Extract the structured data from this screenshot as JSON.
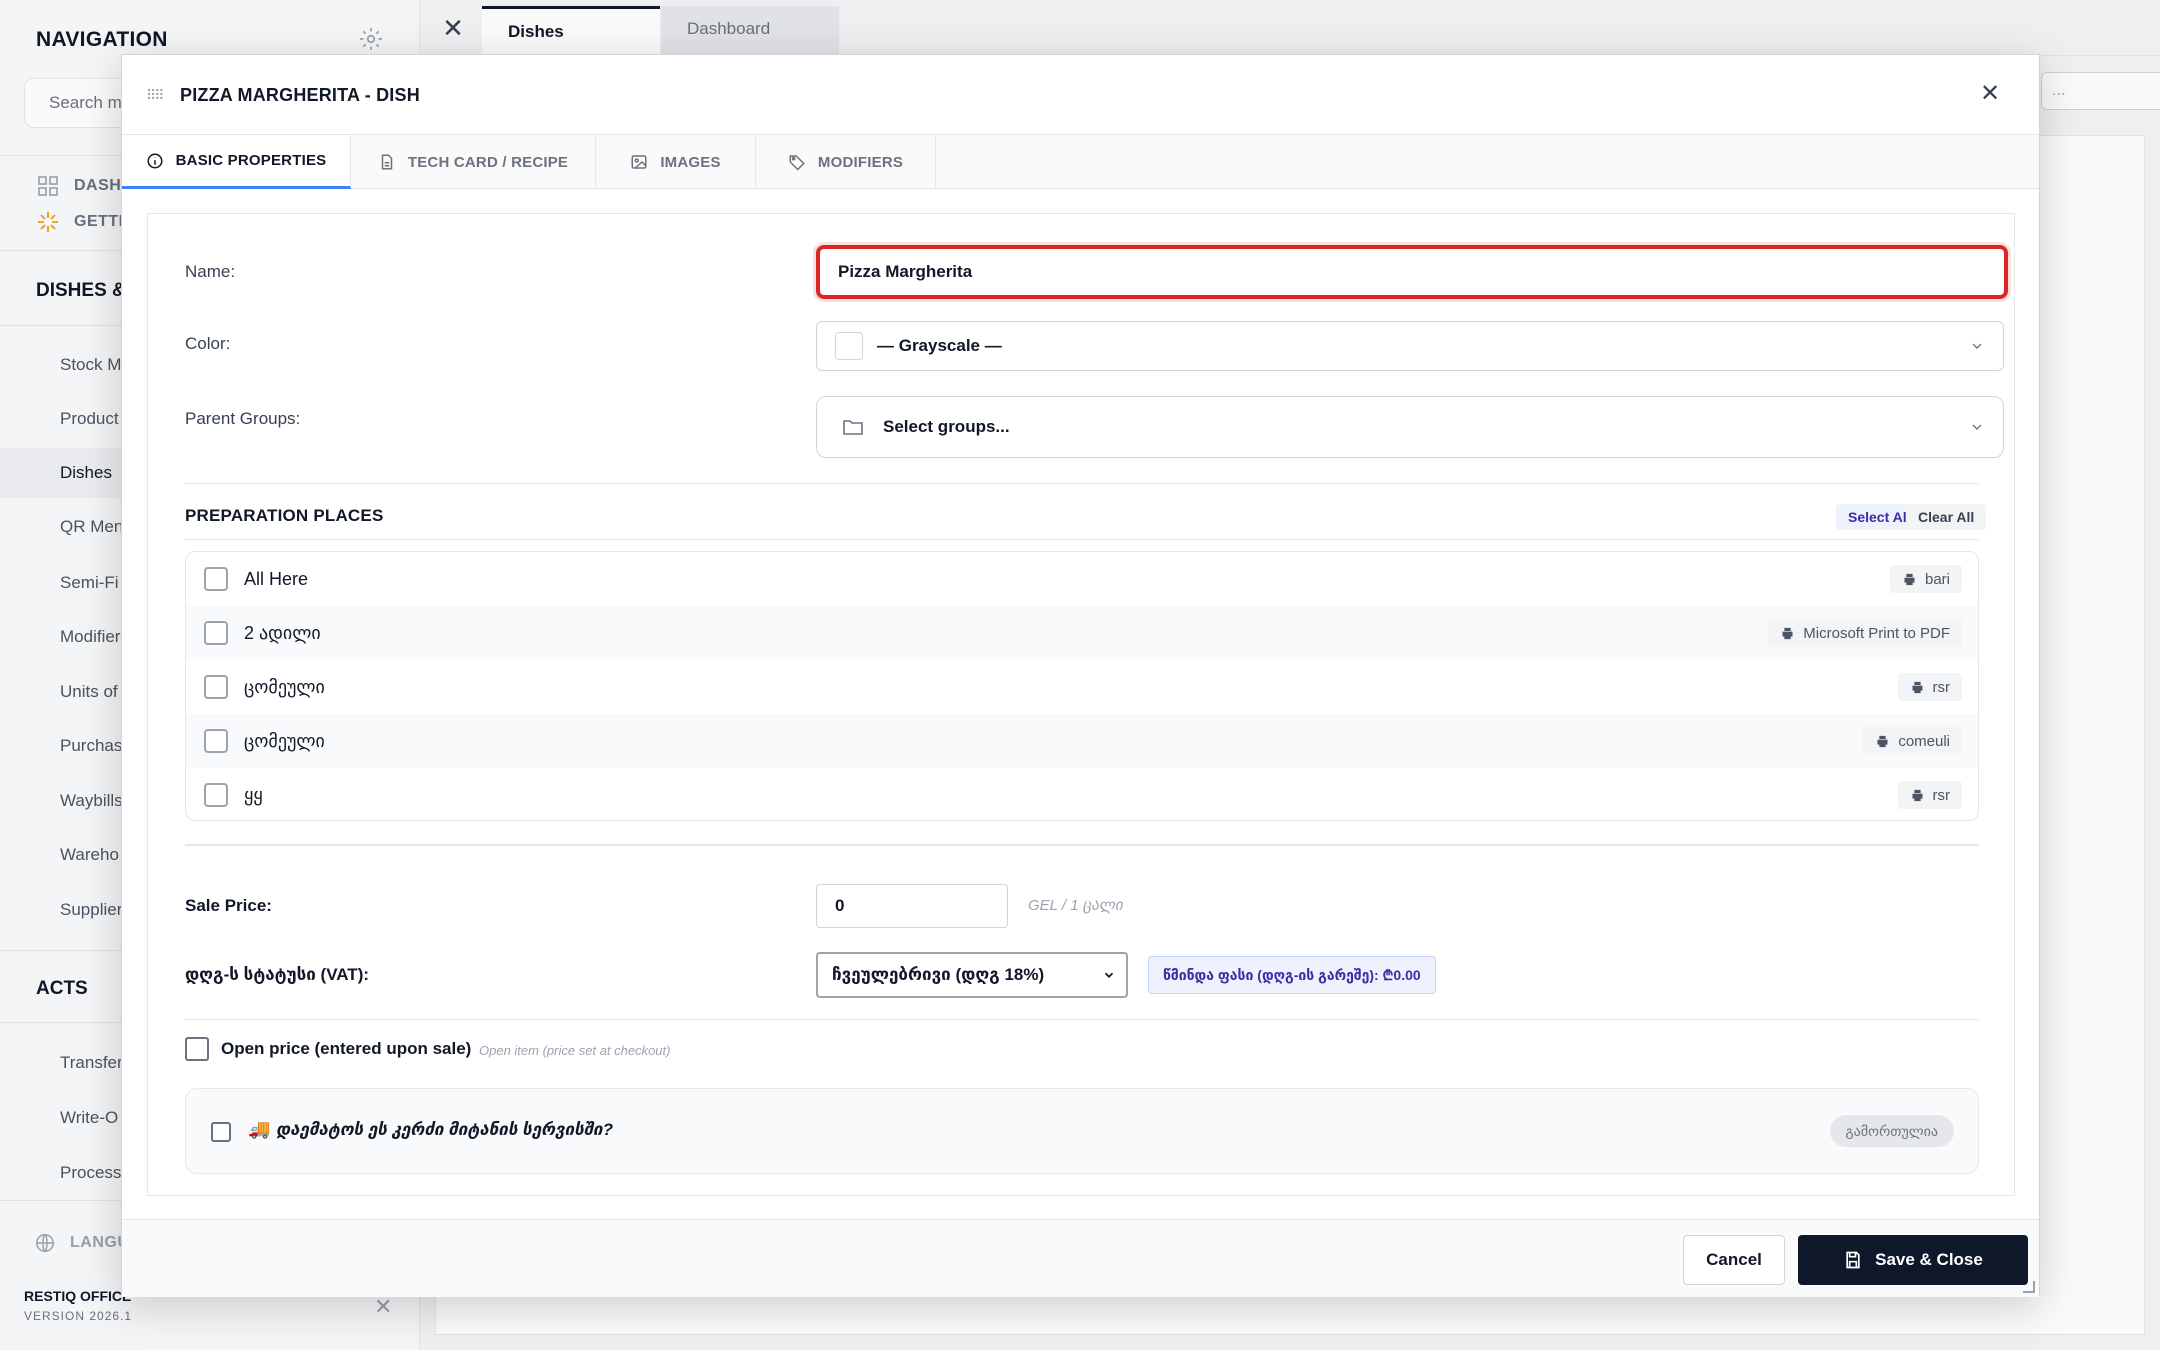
{
  "sidebar": {
    "title": "NAVIGATION",
    "search_placeholder": "Search m",
    "top_items": [
      {
        "label": "DASH"
      },
      {
        "label": "GETTI"
      }
    ],
    "sections": [
      {
        "title": "DISHES &"
      },
      {
        "title": "ACTS"
      }
    ],
    "items": [
      {
        "label": "Stock M"
      },
      {
        "label": "Product"
      },
      {
        "label": "Dishes"
      },
      {
        "label": "QR Men"
      },
      {
        "label": "Semi-Fi"
      },
      {
        "label": "Modifier"
      },
      {
        "label": "Units of"
      },
      {
        "label": "Purchas"
      },
      {
        "label": "Waybills"
      },
      {
        "label": "Wareho"
      },
      {
        "label": "Supplier"
      },
      {
        "label": "Transfer"
      },
      {
        "label": "Write-O"
      },
      {
        "label": "Processi"
      }
    ],
    "language_label": "LANGU",
    "brand": "RESTIQ OFFICE",
    "version": "VERSION 2026.1"
  },
  "page_tabs": [
    {
      "label": "Dishes",
      "active": true
    },
    {
      "label": "Dashboard",
      "active": false
    }
  ],
  "background_search": "...",
  "modal": {
    "title": "PIZZA MARGHERITA - DISH",
    "tabs": [
      {
        "label": "BASIC PROPERTIES",
        "icon": "info-icon",
        "active": true
      },
      {
        "label": "TECH CARD / RECIPE",
        "icon": "document-icon",
        "active": false
      },
      {
        "label": "IMAGES",
        "icon": "image-icon",
        "active": false
      },
      {
        "label": "MODIFIERS",
        "icon": "tag-icon",
        "active": false
      }
    ],
    "fields": {
      "name_label": "Name:",
      "name_value": "Pizza Margherita",
      "color_label": "Color:",
      "color_value": "— Grayscale —",
      "parent_groups_label": "Parent Groups:",
      "parent_groups_value": "Select groups..."
    },
    "preparation": {
      "title": "PREPARATION PLACES",
      "select_all": "Select All",
      "clear_all": "Clear All",
      "places": [
        {
          "name": "All Here",
          "printer": "bari"
        },
        {
          "name": "2 ადილი",
          "printer": "Microsoft Print to PDF"
        },
        {
          "name": "ცომეული",
          "printer": "rsr"
        },
        {
          "name": "ცომეული",
          "printer": "comeuli"
        },
        {
          "name": "ყყ",
          "printer": "rsr"
        }
      ]
    },
    "pricing": {
      "sale_price_label": "Sale Price:",
      "sale_price_value": "0",
      "unit": "GEL / 1 ცალი",
      "vat_label": "დღგ-ს სტატუსი (VAT):",
      "vat_value": "ჩვეულებრივი (დღგ 18%)",
      "net_price": "წმინდა ფასი (დღგ-ის გარეშე): ₾0.00"
    },
    "open_price": {
      "label": "Open price (entered upon sale)",
      "hint": "Open item (price set at checkout)"
    },
    "delivery": {
      "label": "დაემატოს ეს კერძი მიტანის სერვისში?",
      "status": "გამორთულია"
    },
    "footer": {
      "cancel": "Cancel",
      "save": "Save & Close"
    }
  },
  "colors": {
    "accent": "#3b82f6",
    "error": "#dc2626",
    "primary_button": "#0f172a"
  }
}
